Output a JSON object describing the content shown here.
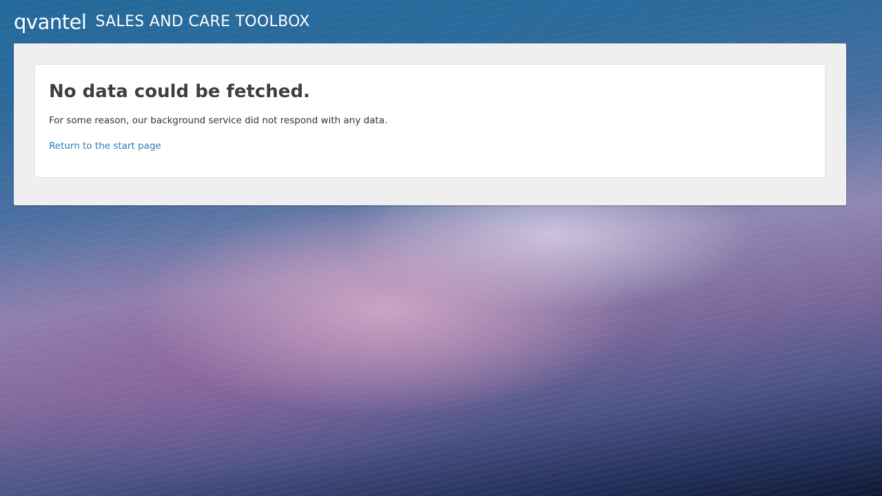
{
  "header": {
    "logo_text": "qvantel",
    "app_title": "SALES AND CARE TOOLBOX"
  },
  "error": {
    "title": "No data could be fetched.",
    "message": "For some reason, our background service did not respond with any data.",
    "link_label": "Return to the start page"
  },
  "colors": {
    "panel_bg": "#efefef",
    "card_bg": "#ffffff",
    "link": "#2a7bb3",
    "heading": "#3e3e3e"
  }
}
